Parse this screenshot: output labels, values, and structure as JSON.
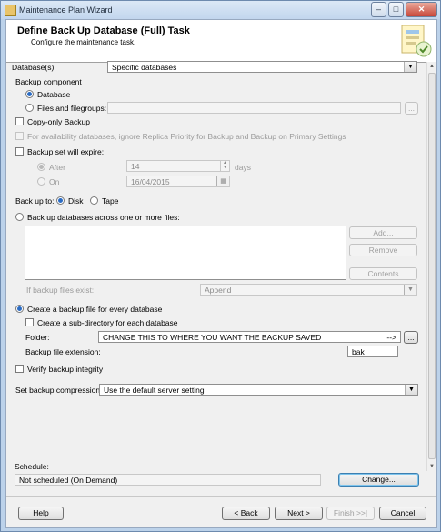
{
  "window": {
    "title": "Maintenance Plan Wizard"
  },
  "header": {
    "title": "Define Back Up Database (Full) Task",
    "subtitle": "Configure the maintenance task."
  },
  "databases": {
    "label": "Database(s):",
    "value": "Specific databases"
  },
  "backup_component": {
    "label": "Backup component",
    "database_option": "Database",
    "files_option": "Files and filegroups:",
    "files_browse": "..."
  },
  "copy_only": {
    "label": "Copy-only Backup"
  },
  "availability": {
    "label": "For availability databases, ignore Replica Priority for Backup and Backup on Primary Settings"
  },
  "expire": {
    "label": "Backup set will expire:",
    "after_label": "After",
    "after_value": "14",
    "after_unit": "days",
    "on_label": "On",
    "on_value": "16/04/2015"
  },
  "backup_to": {
    "label": "Back up to:",
    "disk": "Disk",
    "tape": "Tape"
  },
  "across_files": {
    "label": "Back up databases across one or more files:",
    "add": "Add...",
    "remove": "Remove",
    "contents": "Contents",
    "if_exist_label": "If backup files exist:",
    "if_exist_value": "Append"
  },
  "per_database": {
    "label": "Create a backup file for every database",
    "subdir_label": "Create a sub-directory for each database",
    "folder_label": "Folder:",
    "folder_value": "CHANGE THIS TO WHERE YOU WANT THE BACKUP SAVED",
    "folder_arrow": "-->",
    "folder_browse": "...",
    "extension_label": "Backup file extension:",
    "extension_value": "bak"
  },
  "verify": {
    "label": "Verify backup integrity"
  },
  "compression": {
    "label": "Set backup compression:",
    "value": "Use the default server setting"
  },
  "schedule": {
    "label": "Schedule:",
    "value": "Not scheduled (On Demand)",
    "change": "Change..."
  },
  "footer": {
    "help": "Help",
    "back": "< Back",
    "next": "Next >",
    "finish": "Finish >>|",
    "cancel": "Cancel"
  },
  "icons": {
    "app": "app-icon",
    "dropdown": "chevron-down-icon",
    "calendar": "calendar-icon",
    "wizard": "wizard-graphic-icon"
  }
}
